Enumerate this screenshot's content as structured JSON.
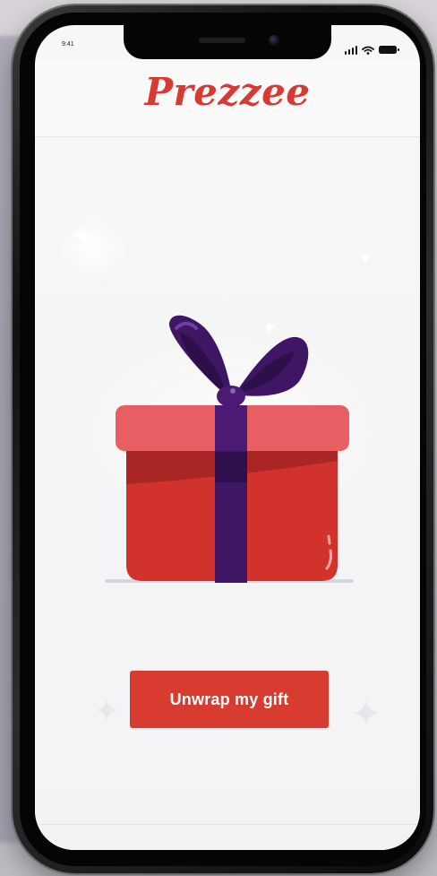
{
  "status_bar": {
    "time": "9:41"
  },
  "header": {
    "logo_text": "Prezzee"
  },
  "main": {
    "primary_button_label": "Unwrap my gift"
  },
  "colors": {
    "brand_red": "#d63a33",
    "button_red": "#d83b2f",
    "ribbon_purple": "#3e1663",
    "lid_pink": "#e85f63",
    "box_red": "#d1322c"
  },
  "icons": {
    "status": [
      "signal-icon",
      "wifi-icon",
      "battery-icon"
    ],
    "illustration": [
      "gift-box-icon",
      "sparkle-icon"
    ]
  }
}
